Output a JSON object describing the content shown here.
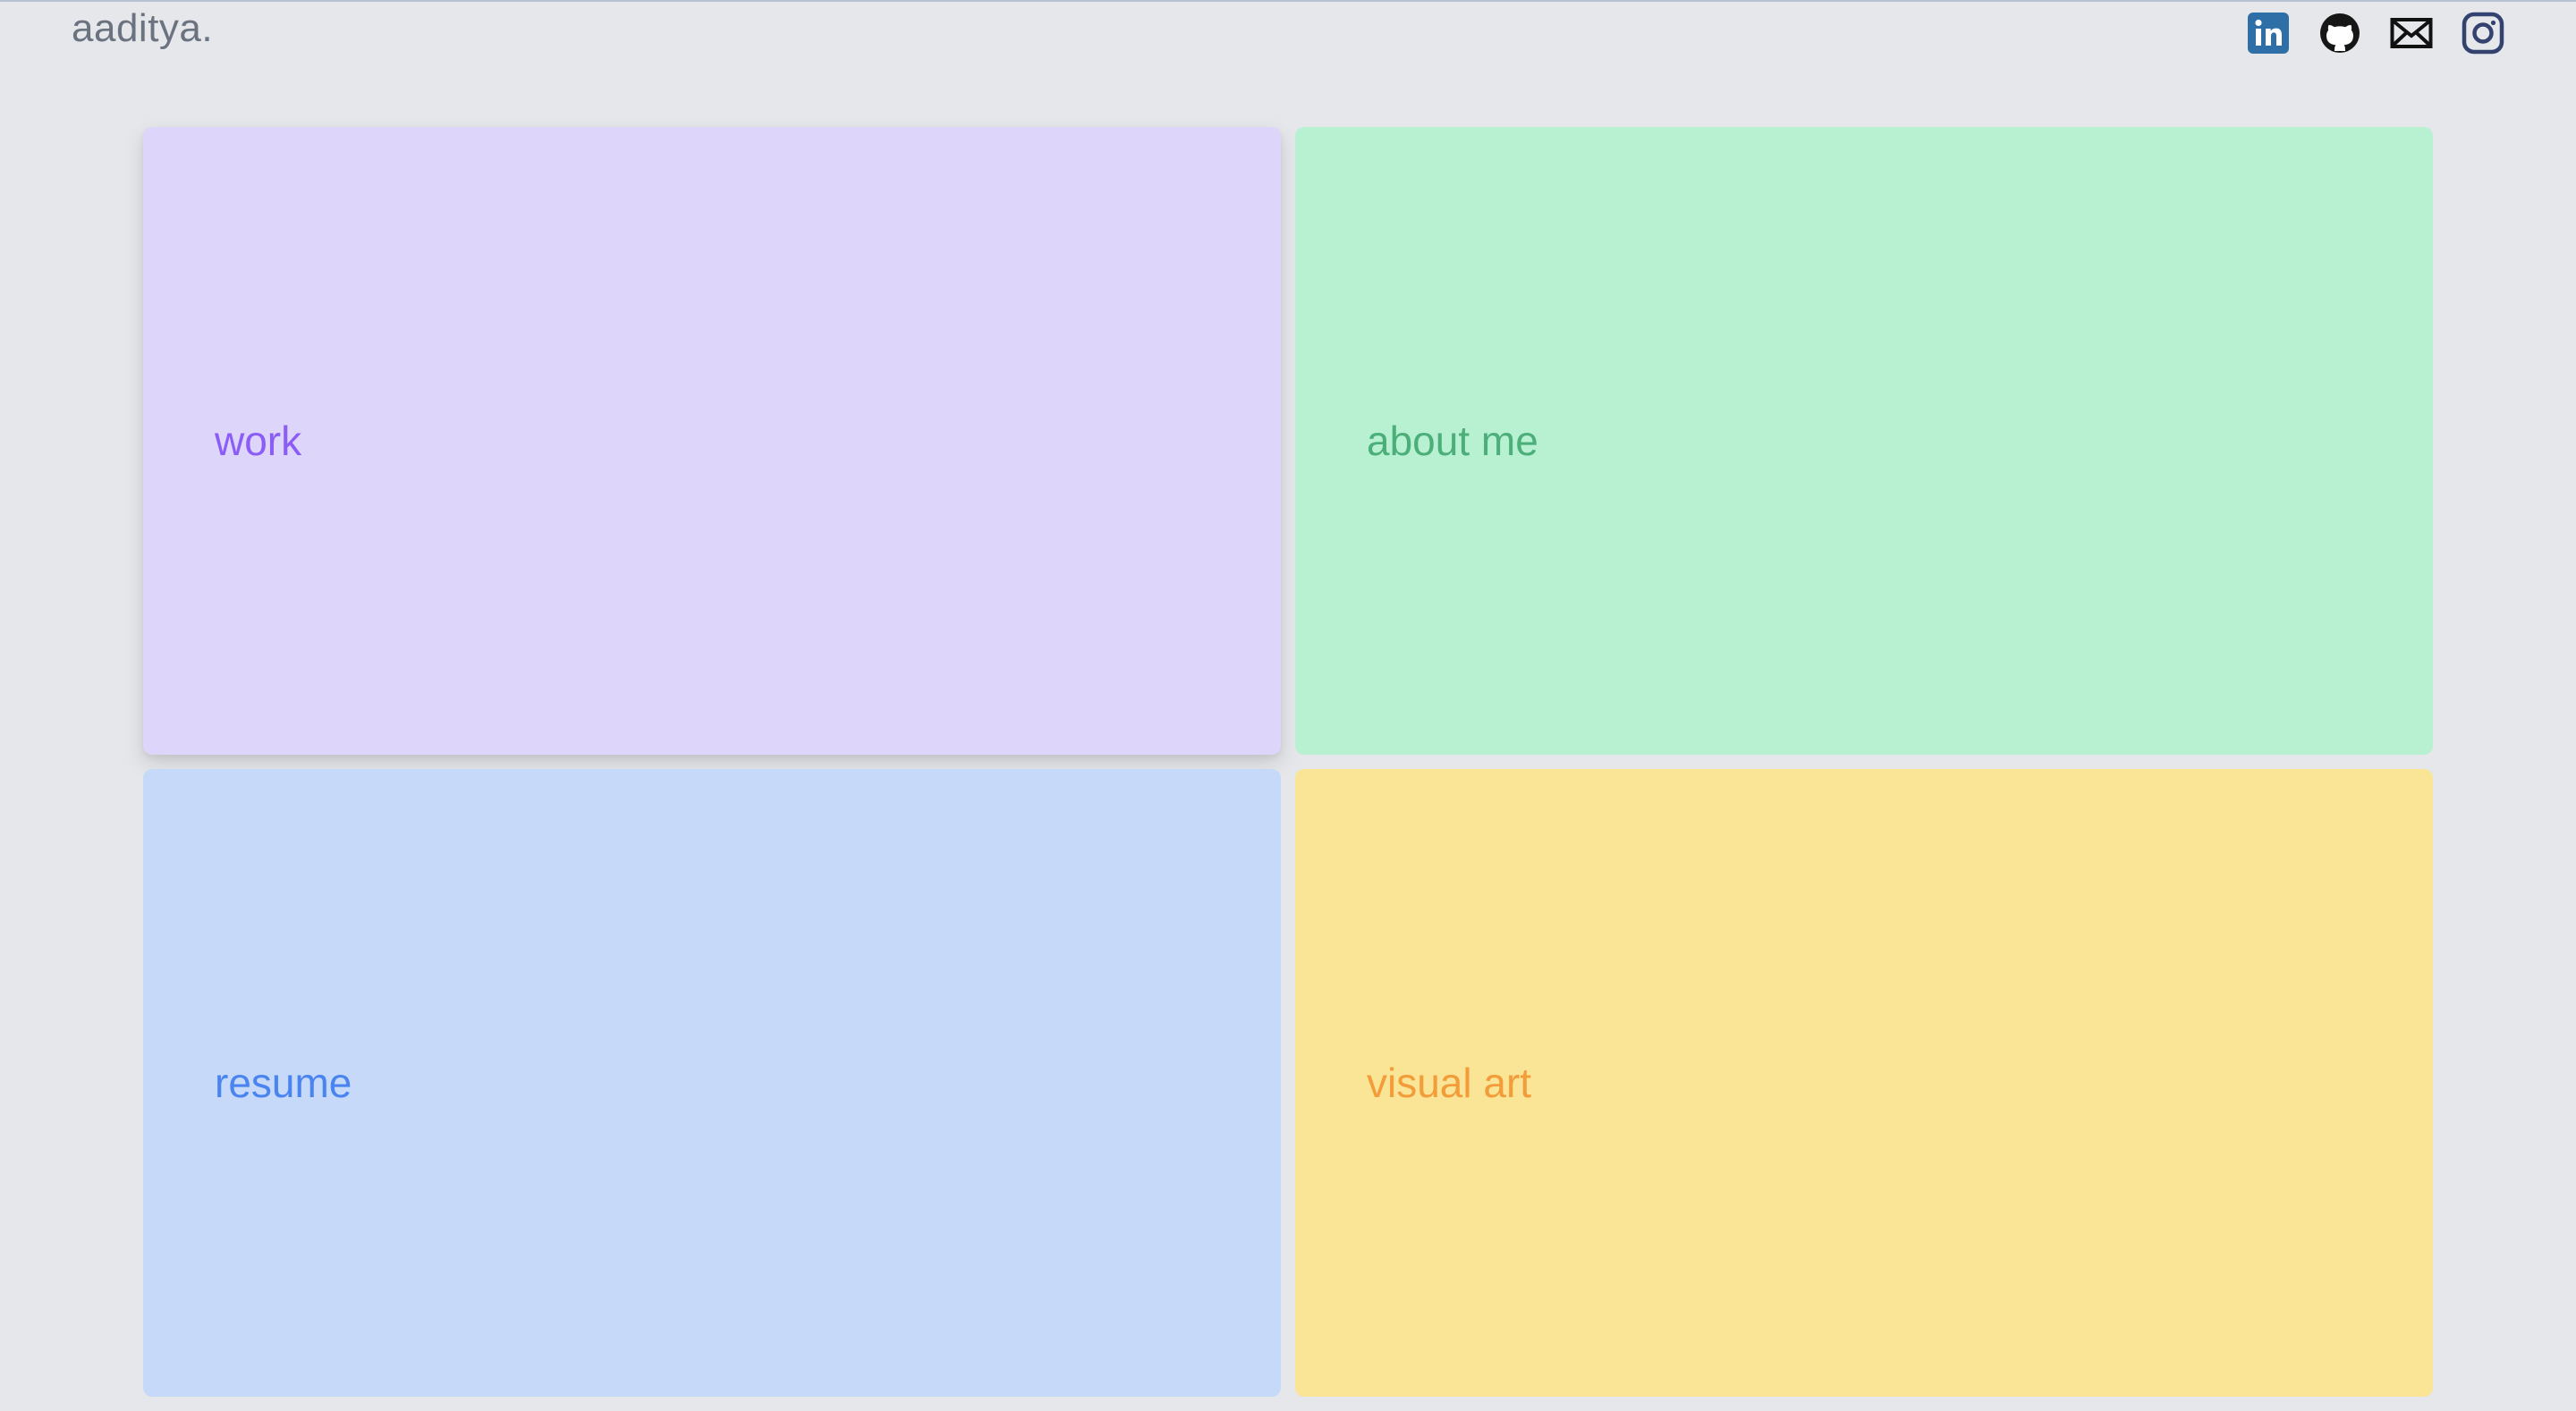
{
  "header": {
    "brand": "aaditya.",
    "social": [
      {
        "icon": "linkedin-icon",
        "color": "#2f6fa7"
      },
      {
        "icon": "github-icon",
        "color": "#161616"
      },
      {
        "icon": "mail-icon",
        "color": "#111111"
      },
      {
        "icon": "instagram-icon",
        "color": "#33426f"
      }
    ]
  },
  "cards": [
    {
      "label": "work",
      "bg": "#ddd6fa",
      "fg": "#8b5cf6"
    },
    {
      "label": "about me",
      "bg": "#b8f1d2",
      "fg": "#4caf7a"
    },
    {
      "label": "resume",
      "bg": "#c6d9f8",
      "fg": "#4a84f0"
    },
    {
      "label": "visual art",
      "bg": "#f9e595",
      "fg": "#f29c3a"
    }
  ]
}
